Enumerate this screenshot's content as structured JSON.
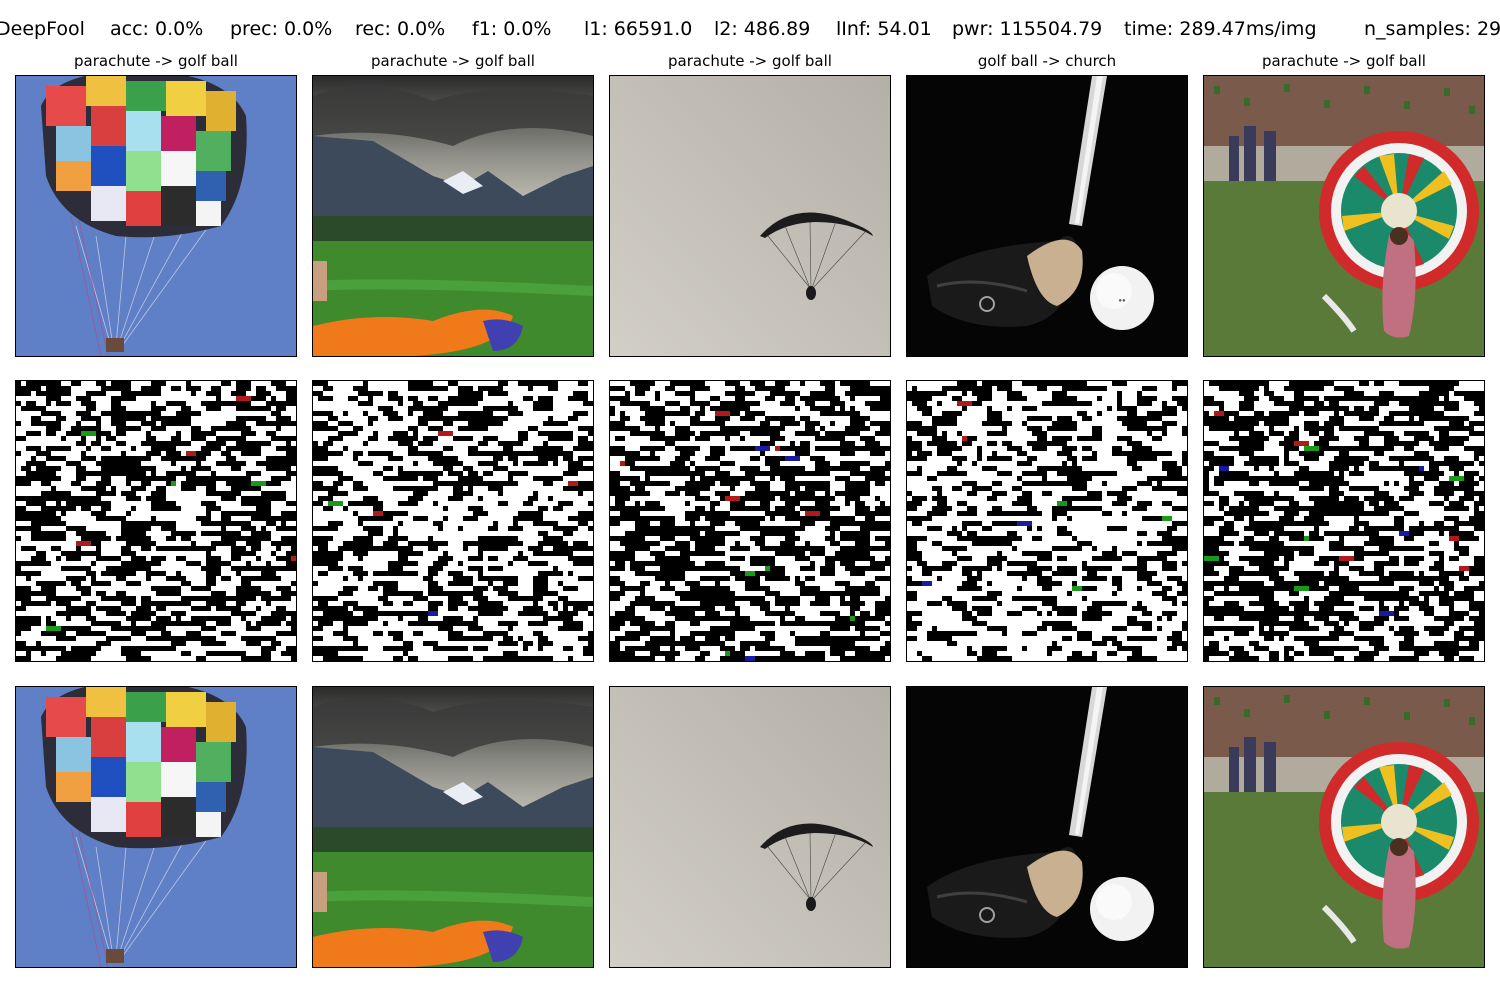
{
  "header": {
    "method": "DeepFool",
    "acc": "acc: 0.0%",
    "prec": "prec: 0.0%",
    "rec": "rec: 0.0%",
    "f1": "f1: 0.0%",
    "l1": "l1: 66591.0",
    "l2": "l2: 486.89",
    "linf": "lInf: 54.01",
    "pwr": "pwr: 115504.79",
    "time": "time: 289.47ms/img",
    "n_samples": "n_samples: 29"
  },
  "columns": [
    {
      "title": "parachute -> golf ball"
    },
    {
      "title": "parachute -> golf ball"
    },
    {
      "title": "parachute -> golf ball"
    },
    {
      "title": "golf ball -> church"
    },
    {
      "title": "parachute -> golf ball"
    }
  ],
  "colors": {
    "sky_blue": "#5f7fc6",
    "field_green": "#3f8a2d",
    "grey_sky": "#c8c5bd",
    "black": "#000000",
    "white": "#ffffff"
  }
}
